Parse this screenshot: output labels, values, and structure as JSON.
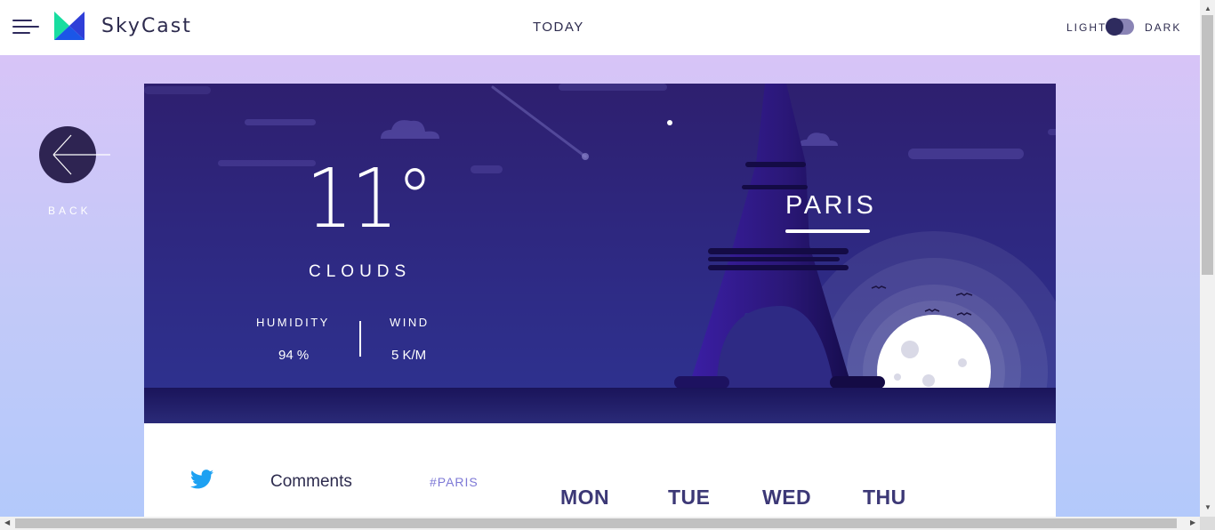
{
  "header": {
    "brand": "SkyCast",
    "nav_title": "TODAY",
    "theme_light": "LIGHT",
    "theme_dark": "DARK",
    "theme_mode": "dark"
  },
  "back": {
    "label": "BACK"
  },
  "weather": {
    "temperature": "11°",
    "condition": "CLOUDS",
    "humidity_label": "HUMIDITY",
    "humidity_value": "94 %",
    "wind_label": "WIND",
    "wind_value": "5 K/M",
    "city": "PARIS"
  },
  "feed": {
    "title": "Comments",
    "hashtag": "#PARIS"
  },
  "forecast": {
    "days": [
      "MON",
      "TUE",
      "WED",
      "THU"
    ]
  },
  "colors": {
    "accent": "#2e2a84",
    "brand_dark": "#2d2b4e",
    "twitter": "#1da1f2",
    "hashtag": "#7d78d6"
  }
}
